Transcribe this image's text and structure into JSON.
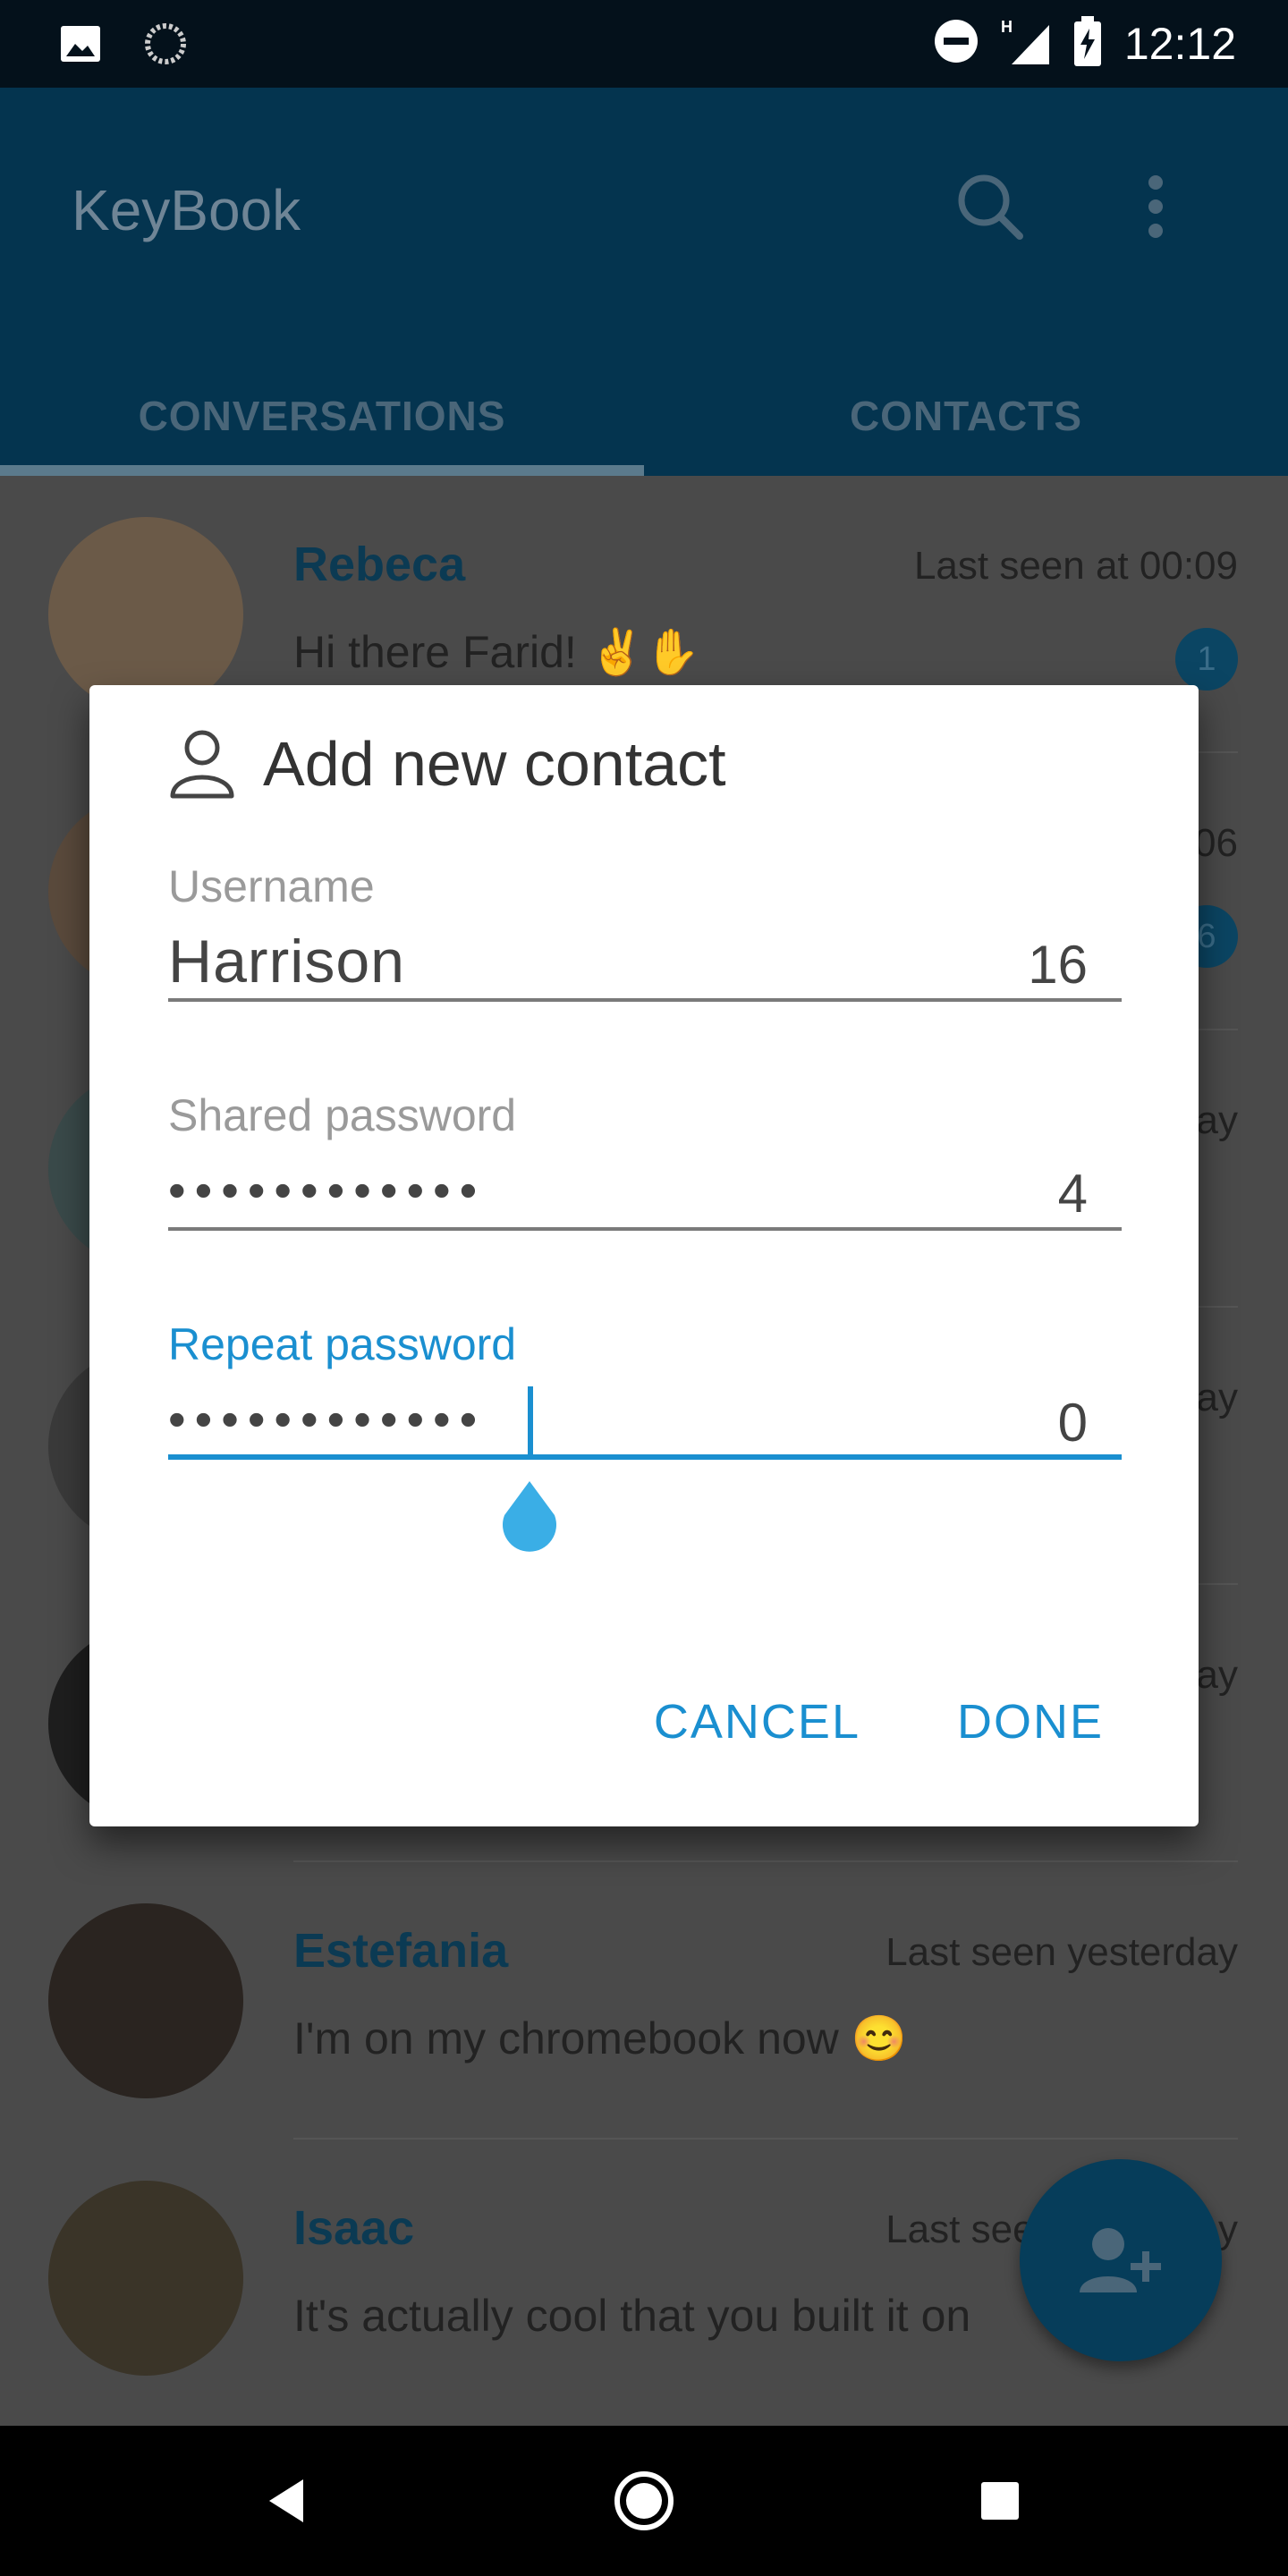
{
  "status_bar": {
    "time": "12:12",
    "icons": [
      "image-icon",
      "sync-icon",
      "do-not-disturb-icon",
      "signal-icon",
      "battery-charging-icon"
    ]
  },
  "app_bar": {
    "title": "KeyBook",
    "search_icon": "search-icon",
    "more_icon": "more-vert-icon"
  },
  "tabs": [
    {
      "label": "CONVERSATIONS",
      "selected": true
    },
    {
      "label": "CONTACTS",
      "selected": false
    }
  ],
  "conversations": [
    {
      "name": "Rebeca",
      "status": "Last seen at 00:09",
      "message": "Hi there Farid! ✌✋",
      "unread": "1"
    },
    {
      "name": "",
      "status": "06",
      "message": "",
      "unread": "6"
    },
    {
      "name": "",
      "status": "ay",
      "message": "",
      "unread": ""
    },
    {
      "name": "",
      "status": "ay",
      "message": "",
      "unread": ""
    },
    {
      "name": "",
      "status": "ay",
      "message": "",
      "unread": ""
    },
    {
      "name": "Estefania",
      "status": "Last seen yesterday",
      "message": "I'm on my chromebook now 😊",
      "unread": ""
    },
    {
      "name": "Isaac",
      "status": "Last seen yesterday",
      "message": "It's actually cool that you built it on",
      "unread": ""
    }
  ],
  "dialog": {
    "title": "Add new contact",
    "icon": "person-outline-icon",
    "fields": {
      "username": {
        "label": "Username",
        "value": "Harrison",
        "counter": "16"
      },
      "shared_password": {
        "label": "Shared password",
        "value": "••••••••••••",
        "counter": "4"
      },
      "repeat_password": {
        "label": "Repeat password",
        "value": "••••••••••••",
        "counter": "0"
      }
    },
    "cancel_label": "CANCEL",
    "done_label": "DONE"
  },
  "colors": {
    "accent": "#1a8fd0",
    "app_bar": "#04344f",
    "fab": "#063d5a"
  }
}
